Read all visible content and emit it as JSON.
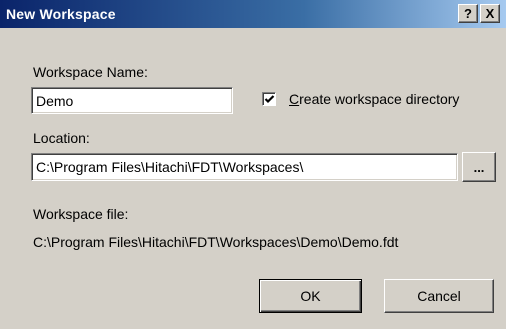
{
  "dialog": {
    "title": "New Workspace",
    "help_label": "?",
    "close_label": "X"
  },
  "form": {
    "workspace_name_label": "Workspace Name:",
    "workspace_name_value": "Demo",
    "create_dir_label_first": "C",
    "create_dir_label_rest": "reate workspace directory",
    "create_dir_checked": true,
    "location_label": "Location:",
    "location_value": "C:\\Program Files\\Hitachi\\FDT\\Workspaces\\",
    "browse_label": "...",
    "workspace_file_label": "Workspace file:",
    "workspace_file_value": "C:\\Program Files\\Hitachi\\FDT\\Workspaces\\Demo\\Demo.fdt"
  },
  "buttons": {
    "ok_label": "OK",
    "cancel_label": "Cancel"
  },
  "colors": {
    "titlebar_start": "#0a246a",
    "titlebar_end": "#a6caf0",
    "face": "#d4d0c8"
  },
  "icons": {
    "checkbox_mark": "check-icon"
  }
}
